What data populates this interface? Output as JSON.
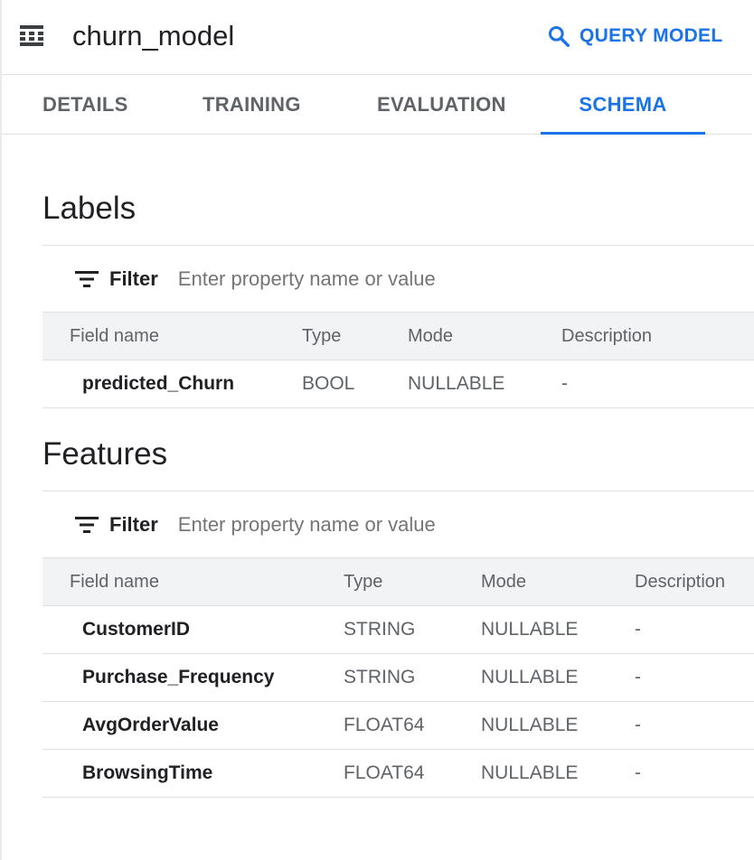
{
  "header": {
    "title": "churn_model",
    "model_icon": "grid-icon",
    "query_button": "QUERY MODEL",
    "query_icon": "search-icon"
  },
  "tabs": [
    {
      "label": "DETAILS",
      "active": false
    },
    {
      "label": "TRAINING",
      "active": false
    },
    {
      "label": "EVALUATION",
      "active": false
    },
    {
      "label": "SCHEMA",
      "active": true
    }
  ],
  "colors": {
    "accent": "#1a73e8",
    "header_bg": "#f1f3f4",
    "divider": "#e0e0e0"
  },
  "labels_section": {
    "title": "Labels",
    "filter": {
      "label": "Filter",
      "placeholder": "Enter property name or value",
      "value": ""
    },
    "columns": [
      "Field name",
      "Type",
      "Mode",
      "Description"
    ],
    "rows": [
      {
        "field": "predicted_Churn",
        "type": "BOOL",
        "mode": "NULLABLE",
        "description": "-"
      }
    ]
  },
  "features_section": {
    "title": "Features",
    "filter": {
      "label": "Filter",
      "placeholder": "Enter property name or value",
      "value": ""
    },
    "columns": [
      "Field name",
      "Type",
      "Mode",
      "Description"
    ],
    "rows": [
      {
        "field": "CustomerID",
        "type": "STRING",
        "mode": "NULLABLE",
        "description": "-"
      },
      {
        "field": "Purchase_Frequency",
        "type": "STRING",
        "mode": "NULLABLE",
        "description": "-"
      },
      {
        "field": "AvgOrderValue",
        "type": "FLOAT64",
        "mode": "NULLABLE",
        "description": "-"
      },
      {
        "field": "BrowsingTime",
        "type": "FLOAT64",
        "mode": "NULLABLE",
        "description": "-"
      }
    ]
  }
}
